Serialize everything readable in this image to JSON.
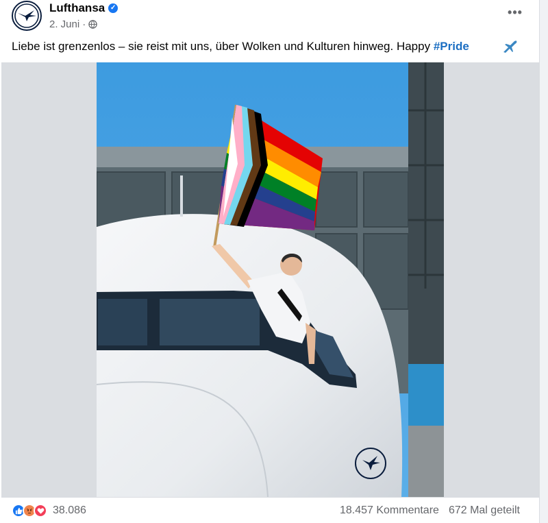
{
  "post": {
    "author": "Lufthansa",
    "verified_icon": "verified-badge-icon",
    "date": "2. Juni",
    "separator": "·",
    "audience_icon": "globe-icon",
    "more_label": "•••",
    "caption_text": "Liebe ist grenzenlos – sie reist mit uns, über Wolken und Kulturen hinweg. Happy ",
    "caption_hashtag": "#Pride",
    "caption_emoji": "airplane-icon"
  },
  "footer": {
    "reaction_icons": [
      "like-icon",
      "angry-icon",
      "love-icon"
    ],
    "reaction_count": "38.086",
    "comments": "18.457 Kommentare",
    "shares": "672 Mal geteilt"
  },
  "colors": {
    "brand_navy": "#0a1d3d",
    "hashtag_blue": "#1b6ec2",
    "like_blue": "#1877f2",
    "sky_blue": "#3d9be0"
  }
}
